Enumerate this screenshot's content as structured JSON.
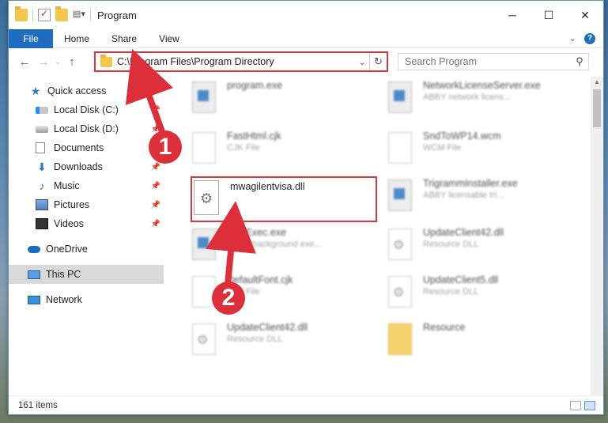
{
  "window": {
    "title": "Program",
    "minimize": "─",
    "maximize": "☐",
    "close": "✕"
  },
  "ribbon": {
    "tabs": [
      "File",
      "Home",
      "Share",
      "View"
    ]
  },
  "address": {
    "path": "C:\\Program Files\\Program Directory",
    "search_placeholder": "Search Program"
  },
  "sidebar": {
    "items": [
      {
        "label": "Quick access",
        "icon": "star-icon"
      },
      {
        "label": "Local Disk (C:)",
        "icon": "disk-icon"
      },
      {
        "label": "Local Disk (D:)",
        "icon": "disk-icon"
      },
      {
        "label": "Documents",
        "icon": "documents-icon"
      },
      {
        "label": "Downloads",
        "icon": "downloads-icon"
      },
      {
        "label": "Music",
        "icon": "music-icon"
      },
      {
        "label": "Pictures",
        "icon": "pictures-icon"
      },
      {
        "label": "Videos",
        "icon": "videos-icon"
      },
      {
        "label": "OneDrive",
        "icon": "cloud-icon"
      },
      {
        "label": "This PC",
        "icon": "computer-icon"
      },
      {
        "label": "Network",
        "icon": "network-icon"
      }
    ]
  },
  "files": [
    {
      "name": "program.exe",
      "desc": "",
      "kind": "exe"
    },
    {
      "name": "NetworkLicenseServer.exe",
      "desc": "ABBY network licens...",
      "kind": "exe"
    },
    {
      "name": "FastHtml.cjk",
      "desc": "CJK File",
      "kind": "doc"
    },
    {
      "name": "SndToWP14.wcm",
      "desc": "WCM File",
      "kind": "doc"
    },
    {
      "name": "TrigrammInstaller.exe",
      "desc": "ABBY licensable tri...",
      "kind": "exe"
    },
    {
      "name": "LineExec.exe",
      "desc": "ABBY background exe...",
      "kind": "exe"
    },
    {
      "name": "UpdateClient42.dll",
      "desc": "Resource DLL",
      "kind": "dll"
    },
    {
      "name": "DefaultFont.cjk",
      "desc": "CJK File",
      "kind": "doc"
    },
    {
      "name": "UpdateClient5.dll",
      "desc": "Resource DLL",
      "kind": "dll"
    },
    {
      "name": "UpdateClient42.dll",
      "desc": "Resource DLL",
      "kind": "dll"
    },
    {
      "name": "Resource",
      "desc": "",
      "kind": "folder"
    }
  ],
  "highlighted_file": {
    "name": "mwagilentvisa.dll"
  },
  "annotations": {
    "step1": "1",
    "step2": "2"
  },
  "status": {
    "count": "161 items"
  },
  "colors": {
    "accent": "#1f6dbf",
    "annotation_red": "#dd2f3a"
  }
}
